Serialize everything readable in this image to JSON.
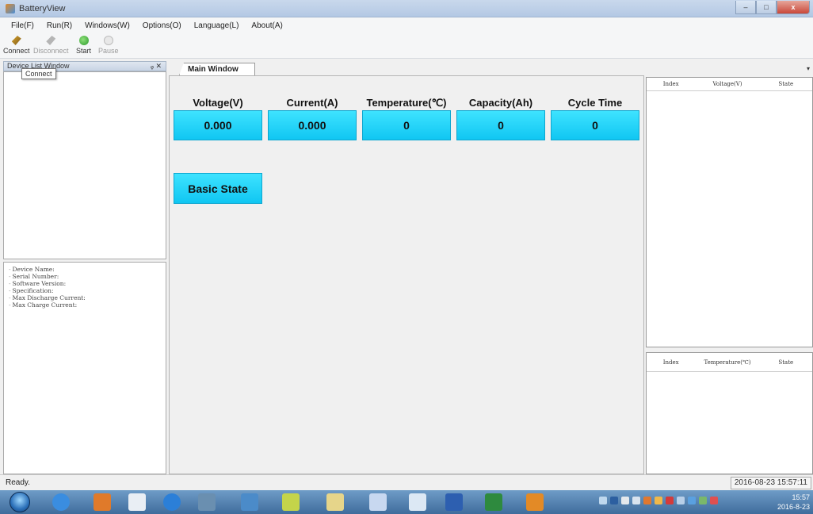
{
  "window": {
    "title": "BatteryView",
    "controls": [
      "–",
      "□",
      "x"
    ]
  },
  "menu": [
    "File(F)",
    "Run(R)",
    "Windows(W)",
    "Options(O)",
    "Language(L)",
    "About(A)"
  ],
  "toolbar": {
    "connect": "Connect",
    "disconnect": "Disconnect",
    "start": "Start",
    "pause": "Pause"
  },
  "tooltip": "Connect",
  "left_panel": {
    "title": "Device List Window",
    "controls": "ᵩ ✕",
    "info": [
      "Device Name:",
      "Serial Number:",
      "Software Version:",
      "Specification:",
      "Max Discharge Current:",
      "Max Charge Current:"
    ]
  },
  "tab": {
    "label": "Main Window",
    "arrow": "▾"
  },
  "metrics": [
    {
      "label": "Voltage(V)",
      "value": "0.000"
    },
    {
      "label": "Current(A)",
      "value": "0.000"
    },
    {
      "label": "Temperature(℃)",
      "value": "0"
    },
    {
      "label": "Capacity(Ah)",
      "value": "0"
    },
    {
      "label": "Cycle Time",
      "value": "0"
    }
  ],
  "basic_state": "Basic State",
  "voltage_grid": {
    "headers": [
      "Index",
      "Voltage(V)",
      "State"
    ]
  },
  "temp_grid": {
    "headers": [
      "Index",
      "Temperature(℃)",
      "State"
    ]
  },
  "status": {
    "ready": "Ready.",
    "datetime": "2016-08-23 15:57:11"
  },
  "taskbar": {
    "time": "15:57",
    "date": "2016-8-23"
  },
  "colors": {
    "metric_fill": "#10c6f2",
    "title_bar": "#b3c8e4",
    "taskbar": "#3f6c9c"
  },
  "icons": [
    "app-icon",
    "connect-icon",
    "disconnect-icon",
    "start-icon",
    "pause-icon",
    "windows-start-icon"
  ]
}
